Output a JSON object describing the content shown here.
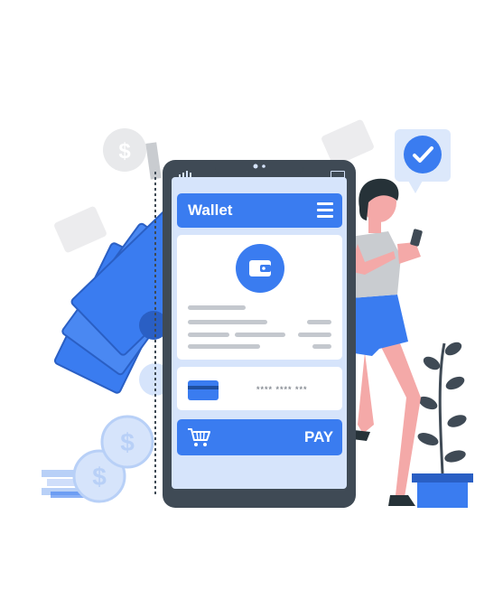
{
  "app": {
    "title": "Wallet",
    "menu_icon": "hamburger-menu-icon"
  },
  "wallet_card": {
    "icon": "wallet-icon"
  },
  "payment_card": {
    "icon": "credit-card-icon",
    "number_masked": "**** **** ***"
  },
  "pay_button": {
    "label": "PAY",
    "icon": "shopping-cart-icon"
  },
  "notification": {
    "icon": "checkmark-icon"
  },
  "colors": {
    "accent": "#3a7cf0",
    "accent_dark": "#1f4f9f",
    "phone_body": "#3f4a55",
    "screen_bg": "#d6e4fb",
    "light_blue": "#dce8fb",
    "placeholder_gray": "#c4c8ce"
  }
}
